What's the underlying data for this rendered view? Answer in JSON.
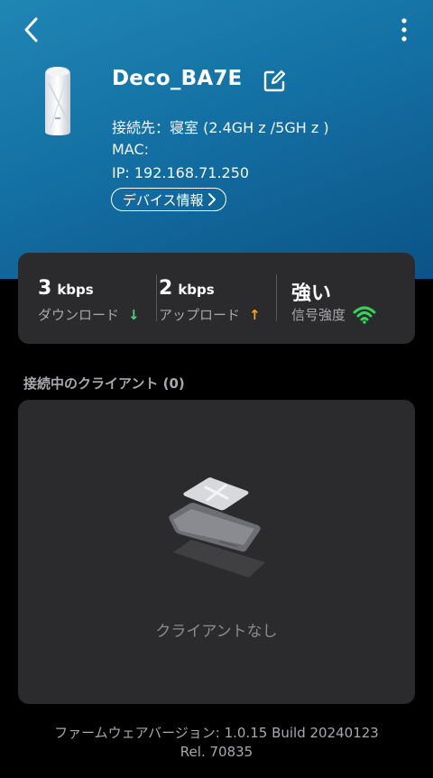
{
  "header": {
    "device_name": "Deco_BA7E",
    "connected_to": "接続先：寝室 (2.4GH z /5GH z )",
    "mac": "MAC:",
    "ip": "IP: 192.168.71.250",
    "device_info_label": "デバイス情報",
    "icons": [
      "back-icon",
      "more-vertical-icon",
      "edit-icon",
      "chevron-right-icon"
    ]
  },
  "stats": {
    "download_value": "3",
    "download_unit": "kbps",
    "download_label": "ダウンロード",
    "download_arrow": "↓",
    "upload_value": "2",
    "upload_unit": "kbps",
    "upload_label": "アップロード",
    "upload_arrow": "↑",
    "signal_value": "強い",
    "signal_label": "信号強度"
  },
  "clients": {
    "title": "接続中のクライアント (0)",
    "empty_text": "クライアントなし"
  },
  "firmware": {
    "line1": "ファームウェアバージョン: 1.0.15 Build 20240123",
    "line2": "Rel. 70835"
  },
  "colors": {
    "hero_top": "#1f86b4",
    "hero_bottom": "#0b5386",
    "card_bg": "#2b2b2d",
    "download_arrow": "#4fd27c",
    "upload_arrow": "#f5a51f",
    "signal_icon": "#36d35b"
  }
}
